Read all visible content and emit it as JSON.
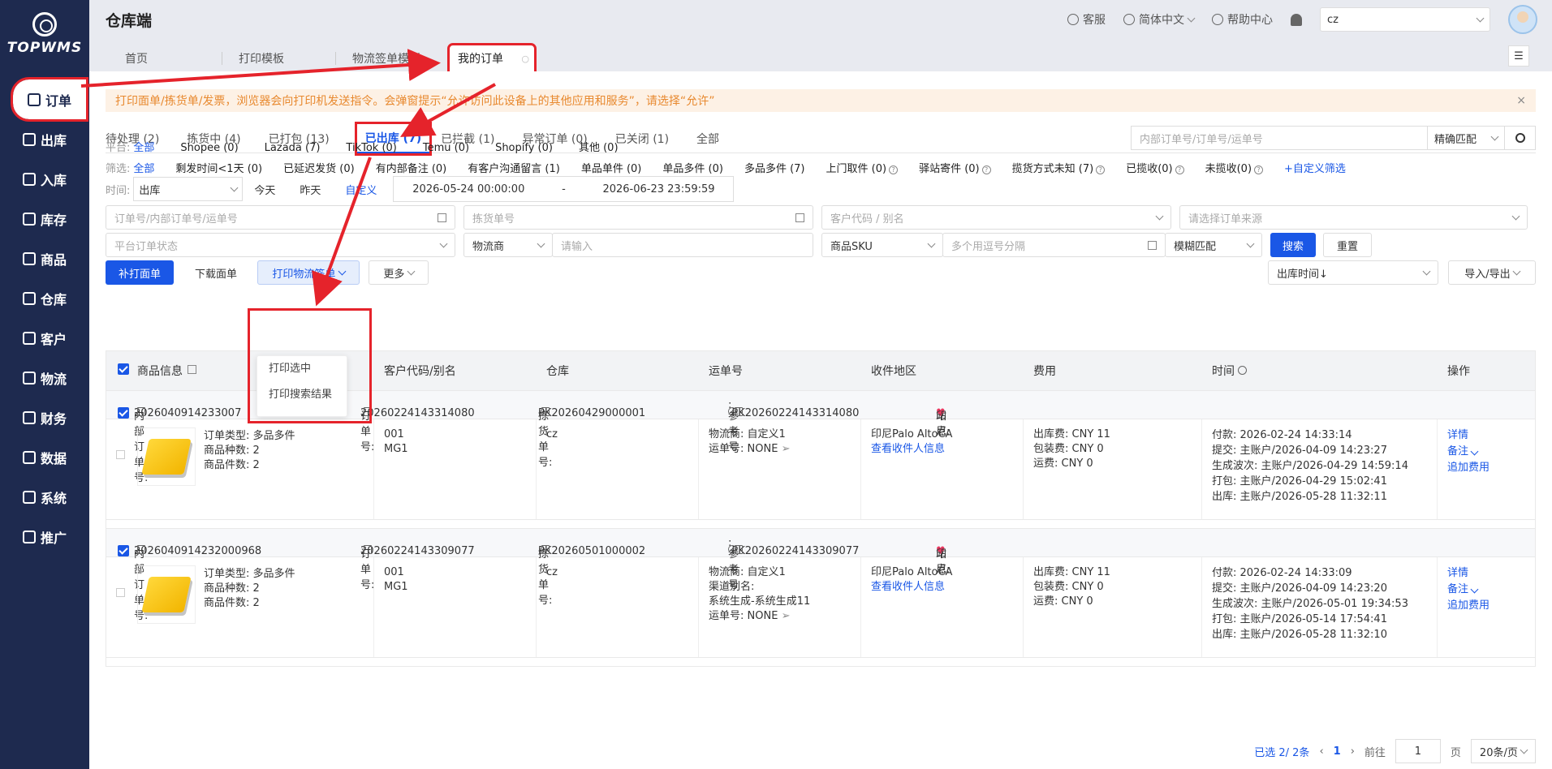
{
  "brand": {
    "name": "TOPWMS"
  },
  "sidebar": {
    "items": [
      {
        "label": "订单",
        "icon": "order-icon"
      },
      {
        "label": "出库",
        "icon": "outbound-icon"
      },
      {
        "label": "入库",
        "icon": "inbound-icon"
      },
      {
        "label": "库存",
        "icon": "inventory-icon"
      },
      {
        "label": "商品",
        "icon": "product-icon"
      },
      {
        "label": "仓库",
        "icon": "warehouse-icon"
      },
      {
        "label": "客户",
        "icon": "customer-icon"
      },
      {
        "label": "物流",
        "icon": "logistics-icon"
      },
      {
        "label": "财务",
        "icon": "finance-icon"
      },
      {
        "label": "数据",
        "icon": "data-icon"
      },
      {
        "label": "系统",
        "icon": "system-icon"
      },
      {
        "label": "推广",
        "icon": "promotion-icon"
      }
    ]
  },
  "header": {
    "title": "仓库端",
    "support": "客服",
    "language": "简体中文",
    "help": "帮助中心",
    "warehouse_value": "cz"
  },
  "page_tabs": [
    "首页",
    "打印模板",
    "物流签单模板",
    "我的订单"
  ],
  "notice": {
    "text": "打印面单/拣货单/发票，浏览器会向打印机发送指令。会弹窗提示“允许访问此设备上的其他应用和服务”，请选择“允许”",
    "close": "×"
  },
  "status_tabs": [
    "待处理 (2)",
    "拣货中 (4)",
    "已打包 (13)",
    "已出库 (7)",
    "已拦截 (1)",
    "异常订单 (0)",
    "已关闭 (1)",
    "全部"
  ],
  "search": {
    "placeholder": "内部订单号/订单号/运单号",
    "match": "精确匹配"
  },
  "platform": {
    "label": "平台:",
    "options": [
      "全部",
      "Shopee (0)",
      "Lazada (7)",
      "TikTok (0)",
      "Temu (0)",
      "Shopify (0)",
      "其他 (0)"
    ]
  },
  "filter": {
    "label": "筛选:",
    "options": [
      "全部",
      "剩发时间<1天 (0)",
      "已延迟发货 (0)",
      "有内部备注 (0)",
      "有客户沟通留言 (1)",
      "单品单件 (0)",
      "单品多件 (0)",
      "多品多件 (7)",
      "上门取件 (0)",
      "驿站寄件 (0)",
      "揽货方式未知 (7)",
      "已揽收(0)",
      "未揽收(0)",
      "+自定义筛选"
    ]
  },
  "time": {
    "label": "时间:",
    "type": "出库",
    "options": [
      "今天",
      "昨天",
      "自定义"
    ],
    "start": "2026-05-24 00:00:00",
    "sep": "-",
    "end": "2026-06-23 23:59:59"
  },
  "fields": {
    "order_no": "订单号/内部订单号/运单号",
    "pick_no": "拣货单号",
    "customer": "客户代码 / 别名",
    "source": "请选择订单来源",
    "platform_status": "平台订单状态",
    "carrier": "物流商",
    "carrier_input": "请输入",
    "sku_type": "商品SKU",
    "sku_input": "多个用逗号分隔",
    "fuzzy": "模糊匹配",
    "search_btn": "搜索",
    "reset_btn": "重置"
  },
  "actions": {
    "reprint": "补打面单",
    "download": "下载面单",
    "print_logistics": "打印物流签单",
    "more": "更多",
    "sort": "出库时间↓",
    "import_export": "导入/导出"
  },
  "dropdown": [
    "打印选中",
    "打印搜索结果"
  ],
  "table": {
    "headers": [
      "商品信息",
      "客户代码/别名",
      "仓库",
      "运单号",
      "收件地区",
      "费用",
      "时间",
      "操作"
    ],
    "orders": [
      {
        "internal_label": "内部订单号:",
        "internal_no": "2026040914233007",
        "order_label": "订单号:",
        "order_no": "20260224143314080",
        "pick_label": "拣货单号:",
        "pick_no": "PK20260429000001",
        "ref_label": "参考号",
        "ref_no": "PK20260224143314080",
        "site_label": "站点:",
        "site": "印尼",
        "type": "订单类型: 多品多件",
        "kinds": "商品种数: 2",
        "count": "商品件数: 2",
        "customer_code": "001",
        "customer_alias": "MG1",
        "warehouse": "cz",
        "carrier": "物流商: 自定义1",
        "channel": "",
        "channel_val": "",
        "tracking": "运单号: NONE",
        "region": "印尼Palo AltoCA",
        "view": "查看收件人信息",
        "fee1": "出库费: CNY 11",
        "fee2": "包装费: CNY 0",
        "fee3": "运费: CNY 0",
        "t1": "付款: 2026-02-24 14:33:14",
        "t2": "提交: 主账户/2026-04-09 14:23:27",
        "t3": "生成波次: 主账户/2026-04-29 14:59:14",
        "t4": "打包: 主账户/2026-04-29 15:02:41",
        "t5": "出库: 主账户/2026-05-28 11:32:11",
        "op1": "详情",
        "op2": "备注",
        "op3": "追加费用"
      },
      {
        "internal_label": "内部订单号:",
        "internal_no": "2026040914232000968",
        "order_label": "订单号:",
        "order_no": "20260224143309077",
        "pick_label": "拣货单号:",
        "pick_no": "PK20260501000002",
        "ref_label": "参考号",
        "ref_no": "PK20260224143309077",
        "site_label": "站点:",
        "site": "印尼",
        "type": "订单类型: 多品多件",
        "kinds": "商品种数: 2",
        "count": "商品件数: 2",
        "customer_code": "001",
        "customer_alias": "MG1",
        "warehouse": "cz",
        "carrier": "物流商: 自定义1",
        "channel": "渠道别名:",
        "channel_val": "系统生成-系统生成11",
        "tracking": "运单号: NONE",
        "region": "印尼Palo AltoCA",
        "view": "查看收件人信息",
        "fee1": "出库费: CNY 11",
        "fee2": "包装费: CNY 0",
        "fee3": "运费: CNY 0",
        "t1": "付款: 2026-02-24 14:33:09",
        "t2": "提交: 主账户/2026-04-09 14:23:20",
        "t3": "生成波次: 主账户/2026-05-01 19:34:53",
        "t4": "打包: 主账户/2026-05-14 17:54:41",
        "t5": "出库: 主账户/2026-05-28 11:32:10",
        "op1": "详情",
        "op2": "备注",
        "op3": "追加费用"
      }
    ]
  },
  "pager": {
    "selected": "已选 2/ 2条",
    "current": "1",
    "goto": "前往",
    "page_input": "1",
    "page_unit": "页",
    "size": "20条/页"
  },
  "colors": {
    "sidebar": "#1e2a4f",
    "accent": "#1a57e6",
    "annotation": "#e5232b",
    "notice": "#e8892f"
  }
}
